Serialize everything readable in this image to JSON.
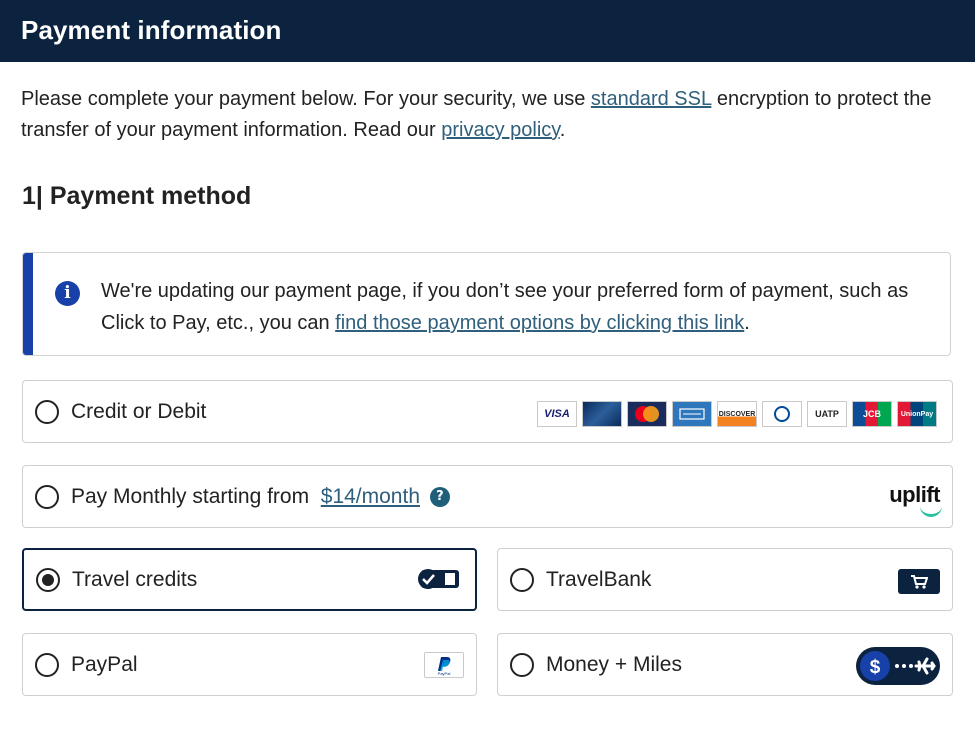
{
  "header": {
    "title": "Payment information"
  },
  "intro": {
    "text_1": "Please complete your payment below. For your security, we use ",
    "ssl_link": "standard SSL",
    "text_2": " encryption to protect the transfer of your payment information. Read our ",
    "privacy_link": "privacy policy",
    "text_3": "."
  },
  "section": {
    "title": "1| Payment method"
  },
  "notice": {
    "text_1": "We're updating our payment page, if you don’t see your preferred form of payment, such as Click to Pay, etc., you can ",
    "link": "find those payment options by clicking this link",
    "text_2": "."
  },
  "options": {
    "credit": {
      "label": "Credit or Debit",
      "cards": [
        {
          "name": "visa",
          "text": "VISA"
        },
        {
          "name": "card-2",
          "text": ""
        },
        {
          "name": "mastercard",
          "text": ""
        },
        {
          "name": "amex",
          "text": ""
        },
        {
          "name": "discover",
          "text": "DISCOVER"
        },
        {
          "name": "diners-club",
          "text": ""
        },
        {
          "name": "uatp",
          "text": "UATP"
        },
        {
          "name": "jcb",
          "text": "JCB"
        },
        {
          "name": "unionpay",
          "text": "UnionPay"
        }
      ]
    },
    "monthly": {
      "label": "Pay Monthly starting from",
      "price": "$14/month",
      "help": "?",
      "brand": "uplift"
    },
    "travel_credits": {
      "label": "Travel credits",
      "selected": true
    },
    "travelbank": {
      "label": "TravelBank"
    },
    "paypal": {
      "label": "PayPal",
      "logo_text": "PayPal"
    },
    "money_miles": {
      "label": "Money + Miles"
    }
  },
  "colors": {
    "header_bg": "#0c2340",
    "link": "#2f5f7c",
    "accent_blue": "#1740a8",
    "uplift_smile": "#2bbf9b"
  }
}
